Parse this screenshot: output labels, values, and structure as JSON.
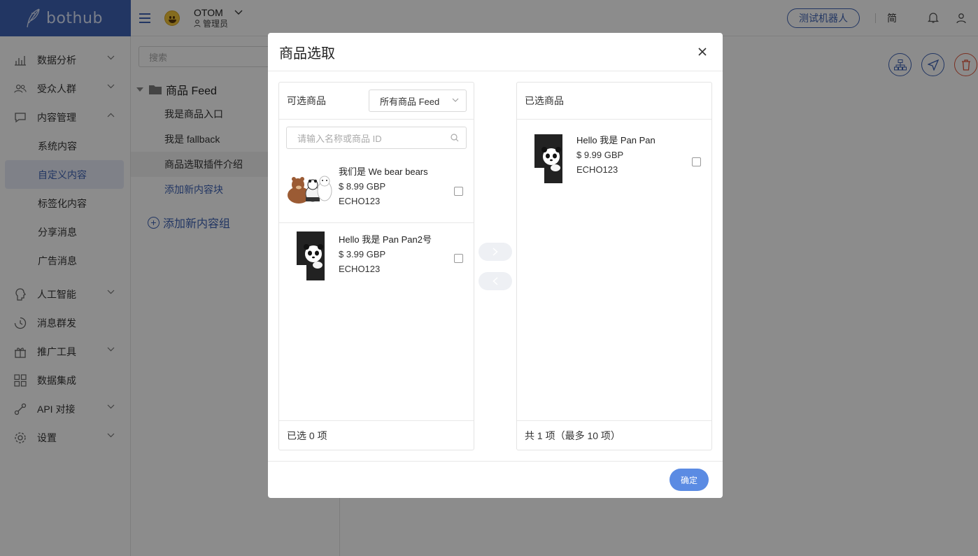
{
  "brand": {
    "logo_text": "bothub"
  },
  "topbar": {
    "account_name": "OTOM",
    "account_role": "管理员",
    "test_bot_label": "测试机器人",
    "lang_label": "简"
  },
  "sidebar": {
    "items": [
      {
        "label": "数据分析",
        "icon": "chart-icon"
      },
      {
        "label": "受众人群",
        "icon": "users-icon"
      },
      {
        "label": "内容管理",
        "icon": "chat-icon"
      },
      {
        "label": "人工智能",
        "icon": "brain-icon"
      },
      {
        "label": "消息群发",
        "icon": "clock-icon"
      },
      {
        "label": "推广工具",
        "icon": "gift-icon"
      },
      {
        "label": "数据集成",
        "icon": "grid-icon"
      },
      {
        "label": "API 对接",
        "icon": "link-icon"
      },
      {
        "label": "设置",
        "icon": "gear-icon"
      }
    ],
    "sub_items": [
      "系统内容",
      "自定义内容",
      "标签化内容",
      "分享消息",
      "广告消息"
    ]
  },
  "content_nav": {
    "search_placeholder": "搜索",
    "root_label": "商品 Feed",
    "leaves": [
      "我是商品入口",
      "我是 fallback",
      "商品选取插件介绍",
      "添加新内容块"
    ],
    "add_group_label": "添加新内容组"
  },
  "modal": {
    "title": "商品选取",
    "confirm_label": "确定",
    "available": {
      "title": "可选商品",
      "feed_select_value": "所有商品 Feed",
      "search_placeholder": "请输入名称或商品 ID",
      "footer": "已选 0 项",
      "products": [
        {
          "name": "我们是 We bear bears",
          "price": "$ 8.99 GBP",
          "code": "ECHO123"
        },
        {
          "name": "Hello 我是 Pan Pan2号",
          "price": "$ 3.99 GBP",
          "code": "ECHO123"
        }
      ]
    },
    "selected": {
      "title": "已选商品",
      "footer": "共 1 项（最多 10 项）",
      "products": [
        {
          "name": "Hello 我是 Pan Pan",
          "price": "$ 9.99 GBP",
          "code": "ECHO123"
        }
      ]
    }
  },
  "colors": {
    "brand": "#3f63b4",
    "confirm": "#5b8be3",
    "danger": "#e0573d"
  }
}
